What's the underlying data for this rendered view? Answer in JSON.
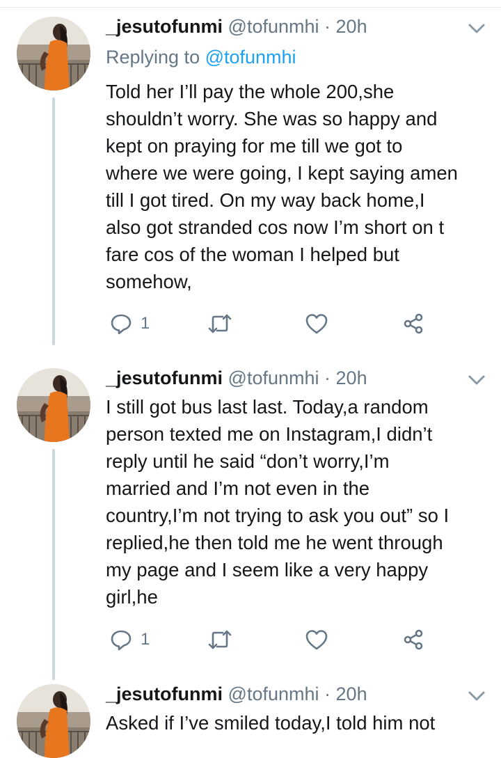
{
  "tweets": [
    {
      "name": "_jesutofunmi",
      "handle": "@tofunmhi",
      "separator": "·",
      "time": "20h",
      "replying_prefix": "Replying to ",
      "replying_to": "@tofunmhi",
      "lines": [
        "Told her I’ll pay the whole 200,she",
        "shouldn’t worry. She was so happy and",
        "kept on praying for me till we got to",
        "where we were going, I kept saying amen",
        "till I got tired. On my way back home,I",
        "also got stranded cos now I’m short on t",
        "fare cos of the woman I helped but",
        "somehow,"
      ],
      "reply_count": "1"
    },
    {
      "name": "_jesutofunmi",
      "handle": "@tofunmhi",
      "separator": "·",
      "time": "20h",
      "lines": [
        "I still got bus last last. Today,a random",
        "person texted me on Instagram,I didn’t",
        "reply until he said “don’t worry,I’m",
        "married and I’m not even in the",
        "country,I’m not trying to ask you out” so I",
        "replied,he then told me he went through",
        "my page and I seem like a very happy",
        "girl,he"
      ],
      "reply_count": "1"
    },
    {
      "name": "_jesutofunmi",
      "handle": "@tofunmhi",
      "separator": "·",
      "time": "20h",
      "lines": [
        "Asked if I’ve smiled today,I told him not"
      ]
    }
  ],
  "icons": {
    "reply": "reply-icon",
    "retweet": "retweet-icon",
    "like": "heart-icon",
    "share": "share-icon",
    "more": "chevron-down-icon"
  },
  "colors": {
    "text": "#14171a",
    "secondary": "#657786",
    "link": "#1da1f2",
    "thread_line": "#ccd6dd"
  }
}
